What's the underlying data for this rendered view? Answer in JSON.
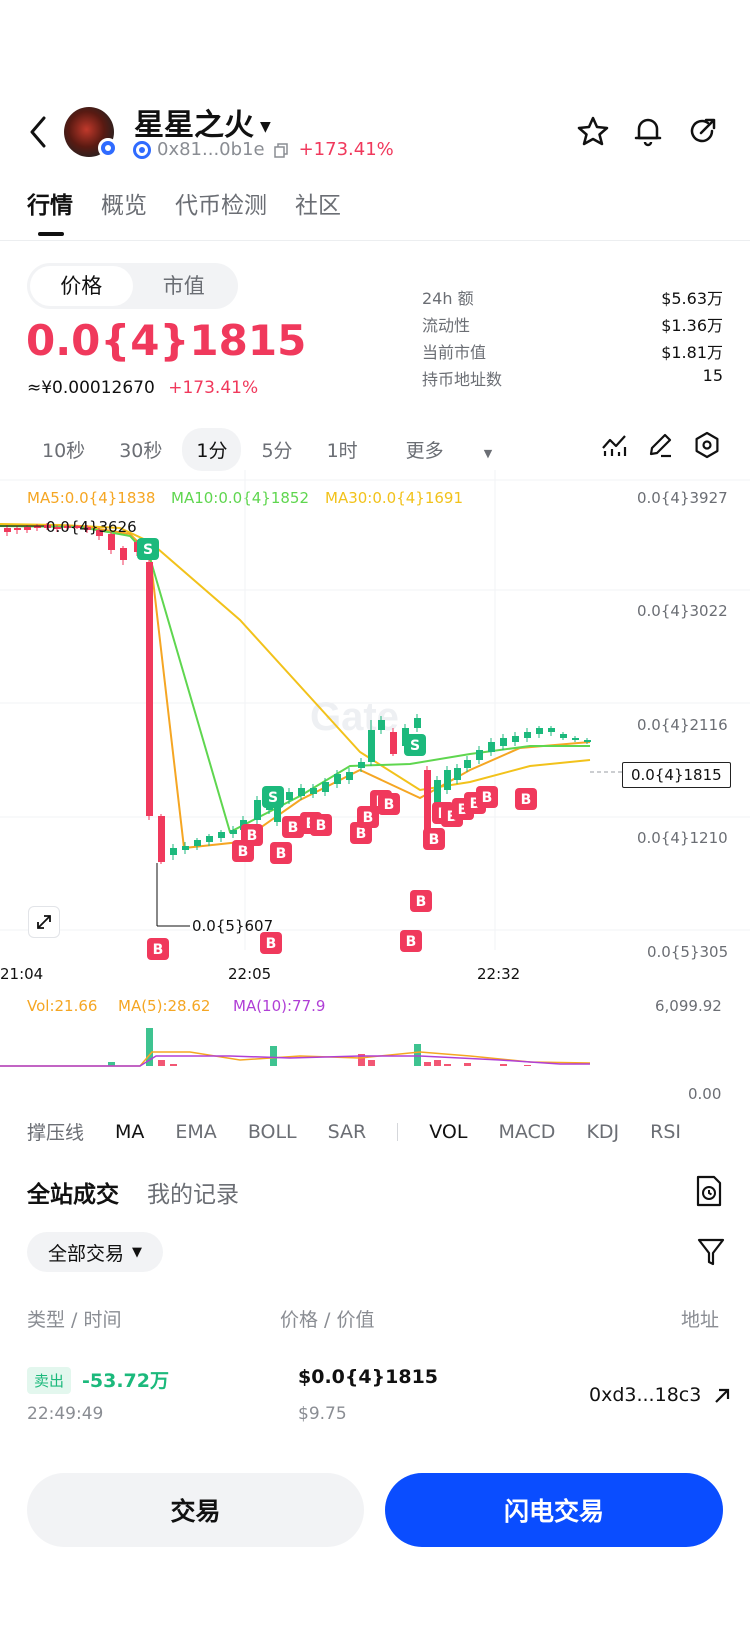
{
  "header": {
    "token_name": "星星之火",
    "address": "0x81...0b1e",
    "change": "+173.41%"
  },
  "tabs": [
    "行情",
    "概览",
    "代币检测",
    "社区"
  ],
  "price_panel": {
    "segments": [
      "价格",
      "市值"
    ],
    "price": "0.0{4}1815",
    "cny_price": "≈¥0.00012670",
    "change": "+173.41%",
    "stats": [
      {
        "label": "24h  额",
        "value": "$5.63万"
      },
      {
        "label": "流动性",
        "value": "$1.36万"
      },
      {
        "label": "当前市值",
        "value": "$1.81万"
      },
      {
        "label": "持币地址数",
        "value": "15"
      }
    ]
  },
  "intervals": [
    "10秒",
    "30秒",
    "1分",
    "5分",
    "1时",
    "更多"
  ],
  "chart": {
    "ma_legend": {
      "ma5": "MA5:0.0{4}1838",
      "ma10": "MA10:0.0{4}1852",
      "ma30": "MA30:0.0{4}1691"
    },
    "y_axis": [
      "0.0{4}3927",
      "0.0{4}3022",
      "0.0{4}2116",
      "0.0{4}1210",
      "0.0{5}305"
    ],
    "x_axis": [
      "21:04",
      "22:05",
      "22:32"
    ],
    "high_label": "0.0{4}3626",
    "low_label": "0.0{5}607",
    "current_price_tag": "0.0{4}1815",
    "watermark": "Gate",
    "volume_legend": {
      "vol": "Vol:21.66",
      "ma5": "MA(5):28.62",
      "ma10": "MA(10):77.9"
    },
    "volume_axis": [
      "6,099.92",
      "0.00"
    ],
    "colors": {
      "up": "#1cb97c",
      "down": "#f0395c",
      "ma5": "#f5a623",
      "ma10": "#5fd64f",
      "ma30": "#f2c21b",
      "vol_ma10": "#b03fd6"
    }
  },
  "indicators": [
    "撑压线",
    "MA",
    "EMA",
    "BOLL",
    "SAR",
    "VOL",
    "MACD",
    "KDJ",
    "RSI"
  ],
  "trades": {
    "tabs": [
      "全站成交",
      "我的记录"
    ],
    "filter": "全部交易",
    "columns": [
      "类型 / 时间",
      "价格 / 价值",
      "地址"
    ],
    "rows": [
      {
        "type": "卖出",
        "qty": "-53.72万",
        "time": "22:49:49",
        "price": "$0.0{4}1815",
        "value": "$9.75",
        "address": "0xd3...18c3"
      }
    ]
  },
  "buttons": {
    "trade": "交易",
    "flash_trade": "闪电交易"
  }
}
